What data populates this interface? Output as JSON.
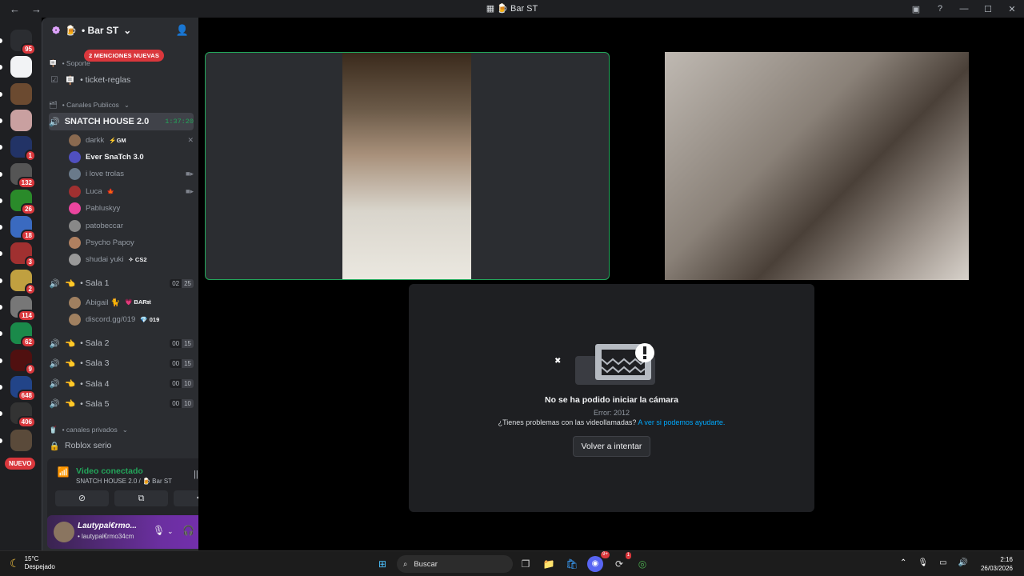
{
  "window": {
    "title": "Bar ST",
    "back": "←",
    "forward": "→",
    "min": "—",
    "max": "☐",
    "close": "✕"
  },
  "rail": {
    "servers": [
      {
        "badge": "95"
      },
      {
        "badge": ""
      },
      {
        "badge": ""
      },
      {
        "badge": ""
      },
      {
        "badge": "1"
      },
      {
        "badge": "132"
      },
      {
        "badge": "26"
      },
      {
        "badge": "18"
      },
      {
        "badge": "3"
      },
      {
        "badge": "2"
      },
      {
        "badge": "114"
      },
      {
        "badge": "62"
      },
      {
        "badge": "9"
      },
      {
        "badge": "648"
      },
      {
        "badge": "406"
      },
      {
        "badge": ""
      }
    ],
    "nuevo": "NUEVO"
  },
  "sidebar": {
    "server_name": "• Bar ST",
    "mentions_pill": "2 MENCIONES NUEVAS",
    "cat_soporte": "• Soporte",
    "ch_ticket": "• ticket-reglas",
    "cat_publicos": "• Canales Publicos",
    "active_channel": "SNATCH HOUSE 2.0",
    "active_timer": "1:37:20",
    "members": [
      {
        "name": "darkk",
        "tag": "⚡GM",
        "bold": false
      },
      {
        "name": "Ever SnaTch 3.0",
        "tag": "",
        "bold": true
      },
      {
        "name": "i love trolas",
        "tag": "",
        "bold": false
      },
      {
        "name": "Luca",
        "tag": "🍁",
        "bold": false
      },
      {
        "name": "Pabluskyy",
        "tag": "",
        "bold": false
      },
      {
        "name": "patobeccar",
        "tag": "",
        "bold": false
      },
      {
        "name": "Psycho Papoy",
        "tag": "",
        "bold": false
      },
      {
        "name": "shudai yuki",
        "tag": "✧ CS2",
        "bold": false
      }
    ],
    "sala1": {
      "name": "• Sala 1",
      "a": "02",
      "b": "25"
    },
    "sala1_members": [
      {
        "name": "Abigail 🐈",
        "tag": "💗 BAR𝔰𝔱"
      },
      {
        "name": "discord.gg/019",
        "tag": "💎 019"
      }
    ],
    "salas": [
      {
        "name": "• Sala 2",
        "a": "00",
        "b": "15"
      },
      {
        "name": "• Sala 3",
        "a": "00",
        "b": "15"
      },
      {
        "name": "• Sala 4",
        "a": "00",
        "b": "10"
      },
      {
        "name": "• Sala 5",
        "a": "00",
        "b": "10"
      }
    ],
    "cat_privados": "• canales privados",
    "ch_roblox": "Roblox serio"
  },
  "voice": {
    "status": "Video conectado",
    "sub": "SNATCH HOUSE 2.0 / 🍺 Bar ST"
  },
  "user": {
    "name": "Lautypal€rmo...",
    "sub": "• lautypal€rmo34cm"
  },
  "error": {
    "title": "No se ha podido iniciar la cámara",
    "code": "Error: 2012",
    "help": "¿Tienes problemas con las videollamadas? ",
    "help_link": "A ver si podemos ayudarte.",
    "retry": "Volver a intentar"
  },
  "taskbar": {
    "temp": "15°C",
    "weather": "Despejado",
    "search": "Buscar",
    "time": "2:16",
    "date": "26/03/2026",
    "discord_badge": "9+",
    "chrome_badge": "1"
  },
  "colors": {
    "accent_green": "#23a55a",
    "danger": "#da373c",
    "link": "#00a8fc"
  }
}
